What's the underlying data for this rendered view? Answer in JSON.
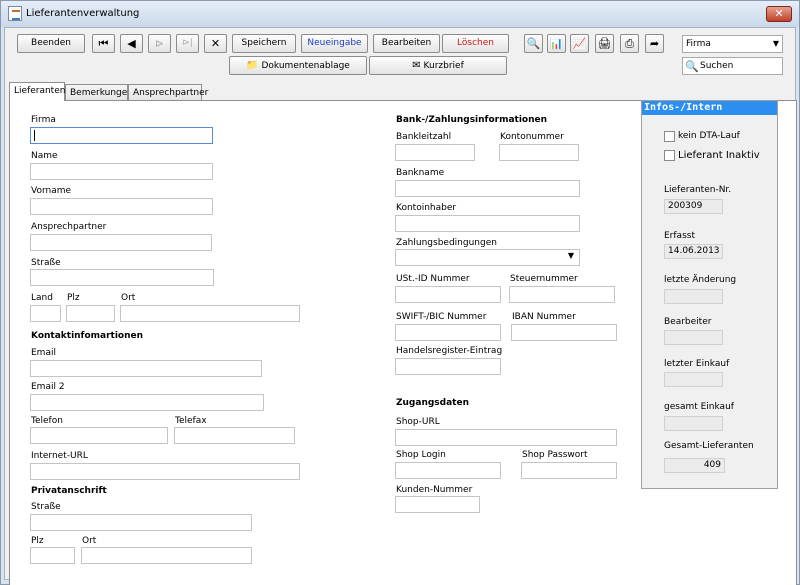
{
  "window": {
    "title": "Lieferantenverwaltung",
    "close_glyph": "✕"
  },
  "toolbar": {
    "beenden": "Beenden",
    "first_glyph": "⏮",
    "prev_glyph": "◀",
    "next_glyph": "⊳",
    "last_glyph": "⊳|",
    "delete_glyph": "✕",
    "speichern": "Speichern",
    "neueingabe": "Neueingabe",
    "bearbeiten": "Bearbeiten",
    "loeschen": "Löschen",
    "dokumentenablage": "Dokumentenablage",
    "kurzbrief": "Kurzbrief"
  },
  "icons": {
    "zoom_glyph": "🔍",
    "chart1_glyph": "📊",
    "chart2_glyph": "📈",
    "print_color_glyph": "🖨",
    "print_glyph": "⎙",
    "export_glyph": "➦",
    "doc_glyph": "📁",
    "brief_glyph": "✉"
  },
  "search": {
    "field_value": "Firma",
    "search_label": "Suchen",
    "search_icon": "🔍"
  },
  "tabs": [
    "Lieferanten",
    "Bemerkungen",
    "Ansprechpartner"
  ],
  "left": {
    "firma": "Firma",
    "name": "Name",
    "vorname": "Vorname",
    "ansprechpartner": "Ansprechpartner",
    "strasse": "Straße",
    "land": "Land",
    "plz": "Plz",
    "ort": "Ort",
    "kontakt_header": "Kontaktinfomartionen",
    "email": "Email",
    "email2": "Email 2",
    "telefon": "Telefon",
    "telefax": "Telefax",
    "internet": "Internet-URL",
    "privat_header": "Privatanschrift",
    "privat_strasse": "Straße",
    "privat_plz": "Plz",
    "privat_ort": "Ort"
  },
  "middle": {
    "bank_header": "Bank-/Zahlungsinformationen",
    "bankleitzahl": "Bankleitzahl",
    "kontonummer": "Kontonummer",
    "bankname": "Bankname",
    "kontoinhaber": "Kontoinhaber",
    "zahlungsbedingungen": "Zahlungsbedingungen",
    "ust_id": "USt.-ID Nummer",
    "steuernummer": "Steuernummer",
    "swift": "SWIFT-/BIC Nummer",
    "iban": "IBAN Nummer",
    "handelsregister": "Handelsregister-Eintrag",
    "zugang_header": "Zugangsdaten",
    "shop_url": "Shop-URL",
    "shop_login": "Shop Login",
    "shop_passwort": "Shop Passwort",
    "kunden_nummer": "Kunden-Nummer"
  },
  "info": {
    "title": "Infos-/Intern",
    "kein_dta": "kein DTA-Lauf",
    "inaktiv": "Lieferant Inaktiv",
    "lief_nr_label": "Lieferanten-Nr.",
    "lief_nr_value": "200309",
    "erfasst_label": "Erfasst",
    "erfasst_value": "14.06.2013",
    "letzte_aenderung_label": "letzte Änderung",
    "letzte_aenderung_value": "",
    "bearbeiter_label": "Bearbeiter",
    "bearbeiter_value": "",
    "letzter_einkauf_label": "letzter Einkauf",
    "letzter_einkauf_value": "",
    "gesamt_einkauf_label": "gesamt Einkauf",
    "gesamt_einkauf_value": "",
    "gesamt_lieferanten_label": "Gesamt-Lieferanten",
    "gesamt_lieferanten_value": "409"
  },
  "dropdown_arrow": "▼"
}
